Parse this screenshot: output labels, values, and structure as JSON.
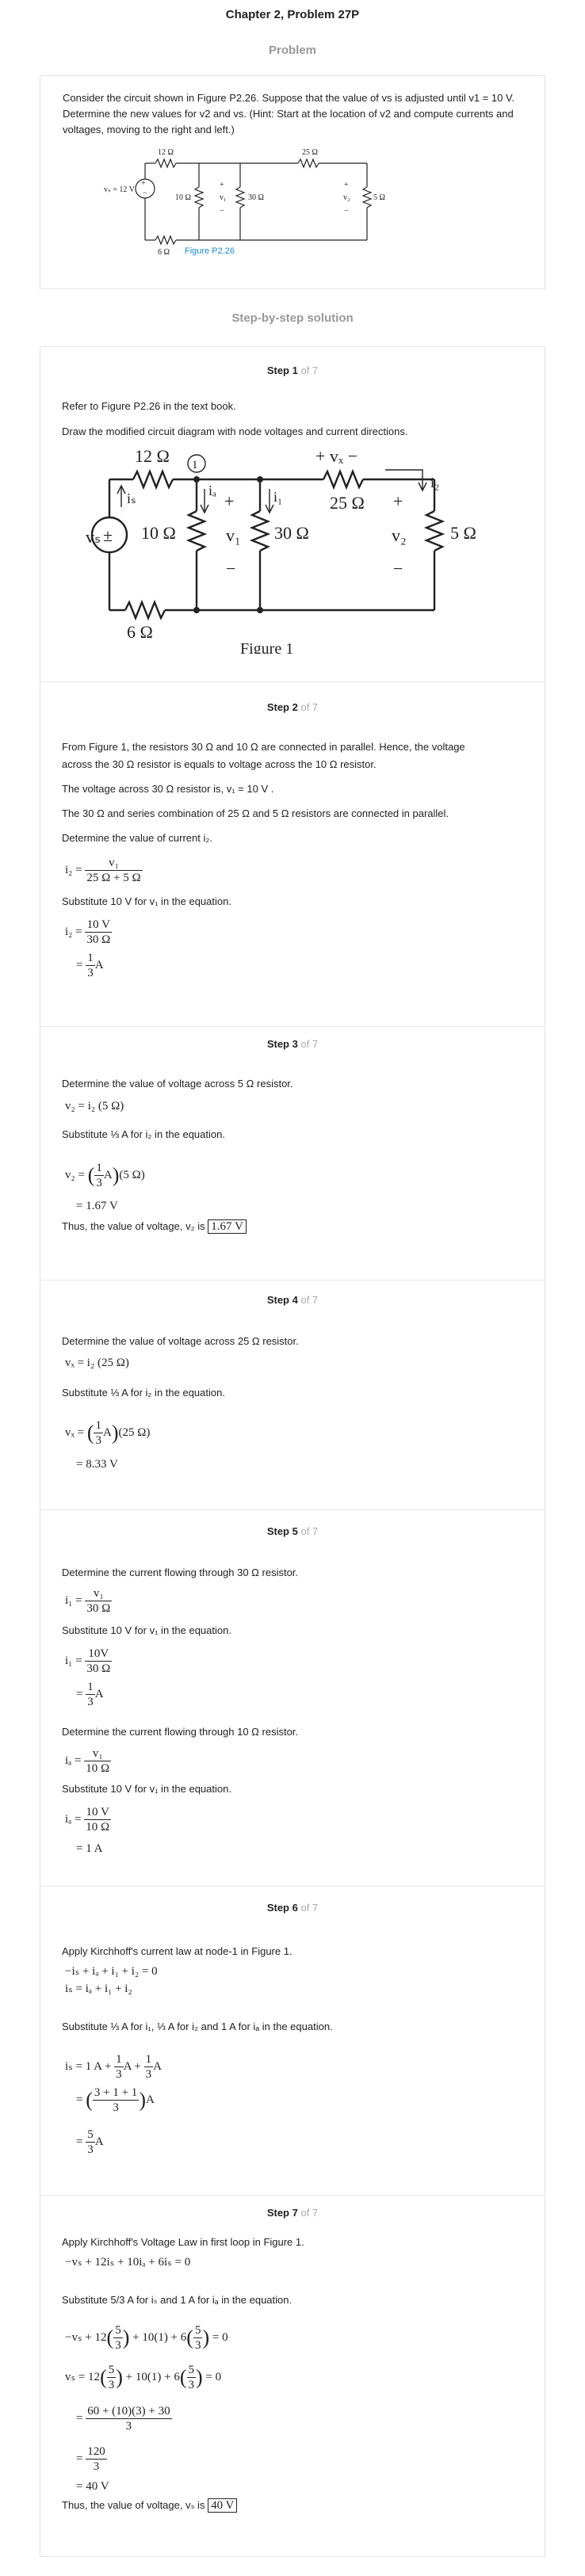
{
  "header": {
    "chapter": "Chapter 2, Problem 27P",
    "problem_label": "Problem",
    "solution_label": "Step-by-step solution"
  },
  "problem": {
    "text": "Consider the circuit shown in Figure P2.26. Suppose that the value of vs is adjusted until v1 = 10 V. Determine the new values for v2 and vs. (Hint: Start at the location of v2 and compute currents and voltages, moving to the right and left.)",
    "figure_caption": "Figure P2.26"
  },
  "colors": {
    "caption_blue": "#1a88d1",
    "muted": "#999999",
    "border": "#e2e2e2"
  },
  "step_total": "7",
  "steps": {
    "s1": {
      "label": "Step 1",
      "of": "of 7",
      "l1": "Refer to Figure P2.26 in the text book.",
      "l2": "Draw the modified circuit diagram with node voltages and current directions.",
      "caption": "Figure 1"
    },
    "s2": {
      "label": "Step 2",
      "of": "of 7",
      "l1": "From Figure 1, the resistors  30 Ω and 10 Ω  are connected in parallel. Hence, the voltage",
      "l2": "across the  30 Ω resistor is equals to voltage across the 10 Ω resistor.",
      "l3": "The voltage across  30 Ω resistor is,  v₁ = 10 V .",
      "l4": "The  30 Ω and series combination of 25 Ω and 5 Ω resistors are connected in parallel.",
      "l5": "Determine the value of current i₂.",
      "sub": "Substitute  10 V  for  v₁ in the equation."
    },
    "s3": {
      "label": "Step 3",
      "of": "of 7",
      "l1": "Determine the value of voltage across  5 Ω resistor.",
      "sub": "Substitute  ⅓ A  for  i₂ in the equation.",
      "res": "= 1.67 V",
      "thus": "Thus, the value of voltage,  v₂  is",
      "ans": "1.67 V"
    },
    "s4": {
      "label": "Step 4",
      "of": "of 7",
      "l1": "Determine the value of voltage across  25 Ω resistor.",
      "sub": "Substitute  ⅓ A  for  i₂ in the equation.",
      "res": "= 8.33 V"
    },
    "s5": {
      "label": "Step 5",
      "of": "of 7",
      "l1": "Determine the current flowing through  30 Ω resistor.",
      "sub": "Substitute  10 V  for  v₁ in the equation.",
      "l2": "Determine the current flowing through  10 Ω resistor.",
      "sub2": "Substitute  10 V  for  v₁ in the equation.",
      "res2": "= 1 A"
    },
    "s6": {
      "label": "Step 6",
      "of": "of 7",
      "l1": "Apply Kirchhoff's current law at node-1 in Figure 1.",
      "eq1": "−iₛ + iₐ + i₁ + i₂ = 0",
      "eq2": "iₛ = iₐ + i₁ + i₂",
      "sub": "Substitute  ⅓ A  for  i₁,  ⅓ A  for  i₂  and  1 A  for  iₐ  in the equation."
    },
    "s7": {
      "label": "Step 7",
      "of": "of 7",
      "l1": "Apply Kirchhoff's Voltage Law in first loop in Figure 1.",
      "eq1": "−vₛ + 12iₛ + 10iₐ + 6iₛ = 0",
      "sub": "Substitute  5/3 A  for  iₛ  and  1 A  for  iₐ  in the equation.",
      "res": "= 40 V",
      "thus": "Thus, the value of voltage,  vₛ  is",
      "ans": "40 V"
    }
  }
}
